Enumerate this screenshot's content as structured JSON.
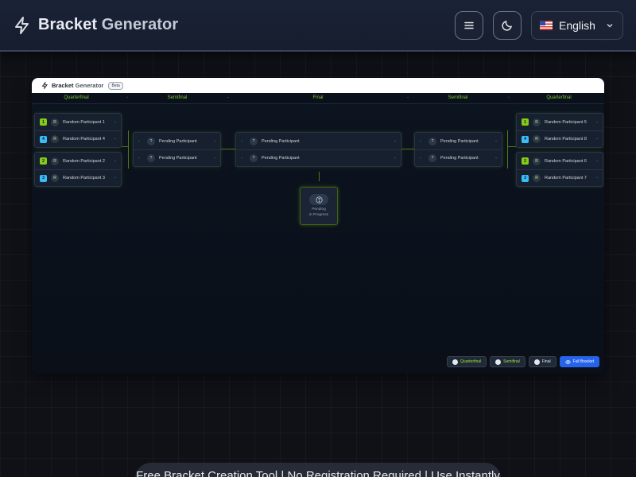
{
  "header": {
    "brand_main": "Bracket",
    "brand_accent": "Generator",
    "language": "English",
    "icons": [
      "lightning-icon",
      "menu-icon",
      "moon-icon",
      "us-flag-icon",
      "chevron-down-icon"
    ]
  },
  "preview": {
    "brand_main": "Bracket",
    "brand_accent": "Generator",
    "badge": "Beta",
    "rounds": {
      "left_qf": "Quarterfinal",
      "left_sf": "Semifinal",
      "final": "Final",
      "right_sf": "Semifinal",
      "right_qf": "Quarterfinal",
      "sep": "-"
    },
    "matches": {
      "qf1": [
        {
          "seed": "1",
          "avatar": "R",
          "name": "Random Participant 1",
          "score": "-"
        },
        {
          "seed": "4",
          "avatar": "R",
          "name": "Random Participant 4",
          "score": "-"
        }
      ],
      "qf2": [
        {
          "seed": "2",
          "avatar": "R",
          "name": "Random Participant 2",
          "score": "-"
        },
        {
          "seed": "3",
          "avatar": "R",
          "name": "Random Participant 3",
          "score": "-"
        }
      ],
      "qf3": [
        {
          "seed": "1",
          "avatar": "R",
          "name": "Random Participant 5",
          "score": "-"
        },
        {
          "seed": "4",
          "avatar": "R",
          "name": "Random Participant 8",
          "score": "-"
        }
      ],
      "qf4": [
        {
          "seed": "2",
          "avatar": "R",
          "name": "Random Participant 6",
          "score": "-"
        },
        {
          "seed": "3",
          "avatar": "R",
          "name": "Random Participant 7",
          "score": "-"
        }
      ],
      "sf_left": [
        {
          "dash": "-",
          "avatar": "?",
          "name": "Pending Participant",
          "score": "-"
        },
        {
          "dash": "-",
          "avatar": "?",
          "name": "Pending Participant",
          "score": "-"
        }
      ],
      "final": [
        {
          "dash": "-",
          "avatar": "?",
          "name": "Pending Participant",
          "score": "-"
        },
        {
          "dash": "-",
          "avatar": "?",
          "name": "Pending Participant",
          "score": "-"
        }
      ],
      "sf_right": [
        {
          "dash": "-",
          "avatar": "?",
          "name": "Pending Participant",
          "score": "-"
        },
        {
          "dash": "-",
          "avatar": "?",
          "name": "Pending Participant",
          "score": "-"
        }
      ]
    },
    "pending": {
      "line1": "Pending",
      "line2": "in Progress"
    },
    "legend": {
      "quarterfinal": "Quarterfinal",
      "semifinal": "Semifinal",
      "final": "Final",
      "full_bracket": "Full Bracket"
    }
  },
  "tagline": "Free Bracket Creation Tool | No Registration Required | Use Instantly"
}
